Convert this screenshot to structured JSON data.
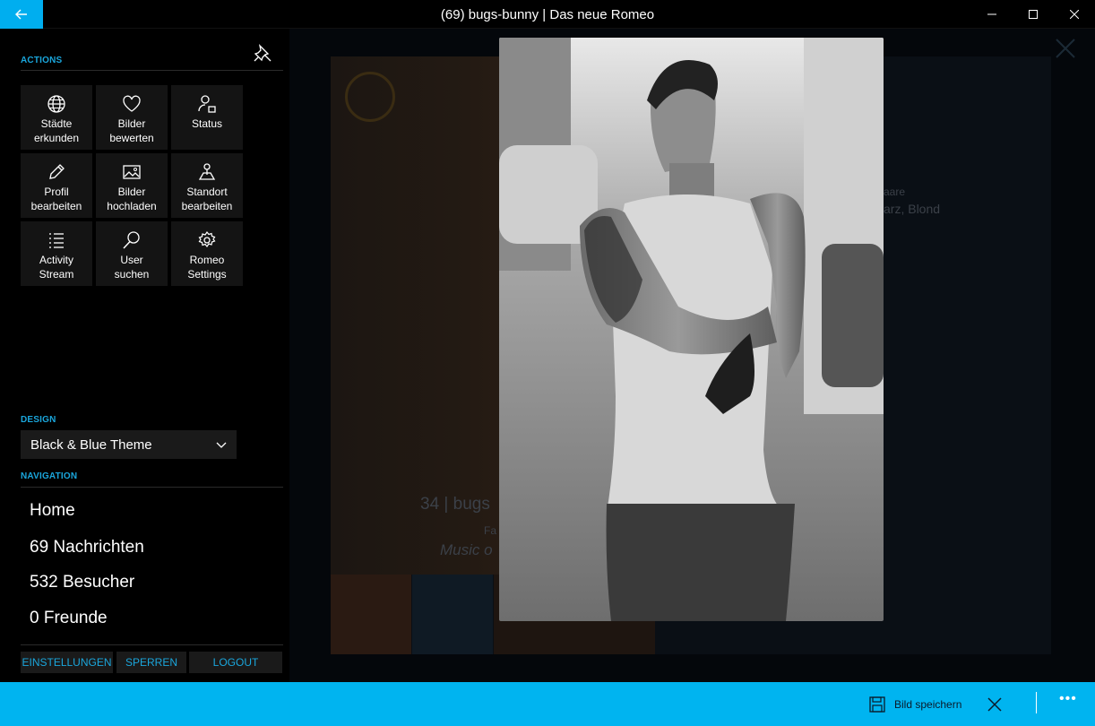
{
  "window": {
    "title": "(69) bugs-bunny | Das neue Romeo"
  },
  "sidebar": {
    "actions_label": "ACTIONS",
    "tiles": [
      {
        "label": "Städte\nerkunden",
        "icon": "globe-icon"
      },
      {
        "label": "Bilder\nbewerten",
        "icon": "heart-icon"
      },
      {
        "label": "Status",
        "icon": "user-status-icon"
      },
      {
        "label": "Profil\nbearbeiten",
        "icon": "pencil-icon"
      },
      {
        "label": "Bilder\nhochladen",
        "icon": "image-icon"
      },
      {
        "label": "Standort\nbearbeiten",
        "icon": "location-icon"
      },
      {
        "label": "Activity\nStream",
        "icon": "list-icon"
      },
      {
        "label": "User\nsuchen",
        "icon": "search-icon"
      },
      {
        "label": "Romeo\nSettings",
        "icon": "gear-icon"
      }
    ],
    "design_label": "DESIGN",
    "design_value": "Black & Blue Theme",
    "navigation_label": "NAVIGATION",
    "nav": [
      "Home",
      "69 Nachrichten",
      "532 Besucher",
      "0  Freunde"
    ],
    "buttons": {
      "settings": "EINSTELLUNGEN",
      "block": "SPERREN",
      "logout": "LOGOUT"
    }
  },
  "background_profile": {
    "name_line": "34 | bugs",
    "sub_line": "Fa",
    "tagline": "Music o",
    "hair": "arz, Blond",
    "hair_label": "aare"
  },
  "appbar": {
    "save_label": "Bild speichern"
  },
  "colors": {
    "accent": "#00b4f0",
    "section_label": "#1aa6dc"
  }
}
